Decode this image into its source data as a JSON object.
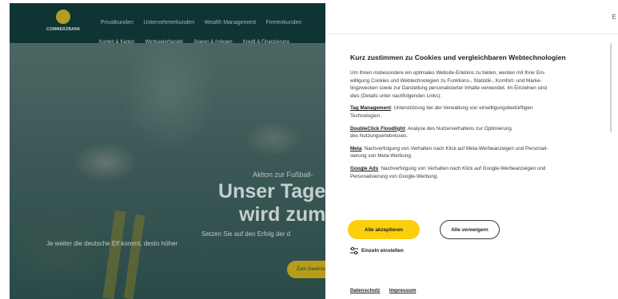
{
  "site": {
    "logo_text": "COMMERZBANK",
    "nav_top": [
      "Privatkunden",
      "Unternehmerkunden",
      "Wealth Management",
      "Firmenkunden"
    ],
    "nav_sub": [
      "Konten & Karten",
      "Wertpapierhandel",
      "Sparen & Anlegen",
      "Kredit & Finanzierung"
    ],
    "hero": {
      "kicker": "Aktion zur Fußball-",
      "title_line1": "Unser Tage",
      "title_line2": "wird zum",
      "copy_line1": "Setzen Sie auf den Erfolg der d",
      "copy_line2": "Je weiter die deutsche Elf kommt, desto höher",
      "cta_label": "Zum Gewinnspiel"
    }
  },
  "consent": {
    "title": "Kurz zustimmen zu Cookies und vergleichbaren Webtechnologien",
    "intro_lines": [
      "Um Ihnen insbesondere ein optimales Website-Erlebnis zu bieten, werden mit Ihrer Ein-",
      "willigung Cookies und Webtechnologien zu Funktions-, Statistik-, Komfort- und Marke-",
      "tingzwecken sowie zur Darstellung personalisierter Inhalte verwendet. Im Einzelnen sind",
      "dies (Details unter nachfolgenden Links):"
    ],
    "items": [
      {
        "name": "Tag Management",
        "line1": ": Unterstützung bei der Verwaltung von einwilligungsbedürftigen",
        "line2": "Technologien."
      },
      {
        "name": "DoubleClick Floodlight",
        "line1": ": Analyse des Nutzerverhaltens zur Optimierung",
        "line2": "des Nutzungserlebnisses."
      },
      {
        "name": "Meta",
        "line1": ": Nachverfolgung von Verhalten nach Klick auf Meta-Werbeanzeigen und Personali-",
        "line2": "sierung von Meta-Werbung."
      },
      {
        "name": "Google Ads",
        "line1": ": Nachverfolgung von Verhalten nach Klick auf Google-Werbeanzeigen und",
        "line2": "Personalisierung von Google-Werbung."
      }
    ],
    "accept_label": "Alle akzeptieren",
    "reject_label": "Alle verweigern",
    "settings_label": "Einzeln einstellen",
    "footer_links": [
      "Datenschutz",
      "Impressum"
    ],
    "close_glyph": "E"
  },
  "colors": {
    "accent_yellow": "#fbcf0b",
    "site_dark": "#123b3b"
  },
  "icons": {
    "settings": "sliders-icon",
    "logo": "commerzbank-logo-icon"
  }
}
